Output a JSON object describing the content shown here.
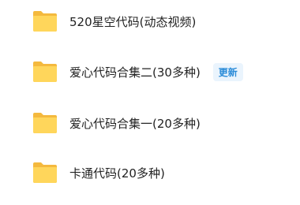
{
  "folders": [
    {
      "name": "520星空代码(动态视频)",
      "icon": "folder-icon"
    },
    {
      "name": "爱心代码合集二(30多种)",
      "icon": "folder-icon",
      "badge": "更新"
    },
    {
      "name": "爱心代码合集一(20多种)",
      "icon": "folder-icon"
    },
    {
      "name": "卡通代码(20多种)",
      "icon": "folder-icon"
    }
  ],
  "colors": {
    "folder_back": "#F4B93E",
    "folder_front": "#FFD65B",
    "badge_text": "#2A8BD8",
    "badge_bg": "#EAF4FD",
    "label_text": "#222222"
  }
}
